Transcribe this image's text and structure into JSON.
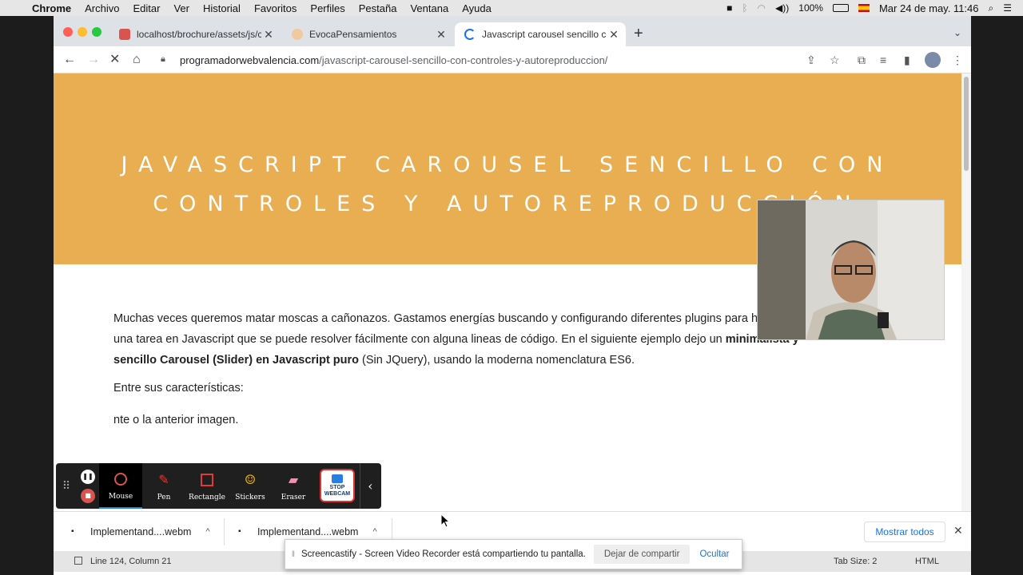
{
  "menubar": {
    "items": [
      "Chrome",
      "Archivo",
      "Editar",
      "Ver",
      "Historial",
      "Favoritos",
      "Perfiles",
      "Pestaña",
      "Ventana",
      "Ayuda"
    ],
    "battery": "100%",
    "datetime": "Mar 24 de may.  11:46"
  },
  "browser": {
    "tabs": [
      {
        "title": "localhost/brochure/assets/js/c",
        "favicon_color": "#d9534f"
      },
      {
        "title": "EvocaPensamientos",
        "favicon_color": "#f0c9a0"
      },
      {
        "title": "Javascript carousel sencillo co",
        "favicon_color": "#1a73e8"
      }
    ],
    "url_host": "programadorwebvalencia.com",
    "url_path": "/javascript-carousel-sencillo-con-controles-y-autoreproduccion/"
  },
  "page": {
    "hero_title": "JAVASCRIPT CAROUSEL SENCILLO CON CONTROLES Y AUTOREPRODUCCIÓN",
    "hero_color": "#e9ae52",
    "para_start": "Muchas veces queremos matar moscas a cañonazos. Gastamos energías buscando y configurando diferentes plugins para hacer una tarea en Javascript que se puede resolver fácilmente con alguna lineas de código. En el siguiente ejemplo dejo un ",
    "para_bold": "minimalista y sencillo Carousel (Slider) en Javascript puro",
    "para_end": " (Sin JQuery), usando la moderna nomenclatura ES6.",
    "features_intro": "Entre sus características:",
    "feature_line": "nte o la anterior imagen."
  },
  "annotation_toolbar": {
    "tools": [
      {
        "label": "Mouse",
        "icon": "mouse-cursor-icon"
      },
      {
        "label": "Pen",
        "icon": "pen-icon"
      },
      {
        "label": "Rectangle",
        "icon": "rectangle-icon"
      },
      {
        "label": "Stickers",
        "icon": "sticker-icon"
      },
      {
        "label": "Eraser",
        "icon": "eraser-icon"
      }
    ],
    "stop_webcam": "STOP WEBCAM"
  },
  "downloads": {
    "items": [
      "Implementand....webm",
      "Implementand....webm"
    ],
    "show_all": "Mostrar todos"
  },
  "editor_status": {
    "position": "Line 124, Column 21",
    "tab_size": "Tab Size: 2",
    "language": "HTML"
  },
  "share_banner": {
    "message": "Screencastify - Screen Video Recorder está compartiendo tu pantalla.",
    "stop": "Dejar de compartir",
    "hide": "Ocultar"
  }
}
